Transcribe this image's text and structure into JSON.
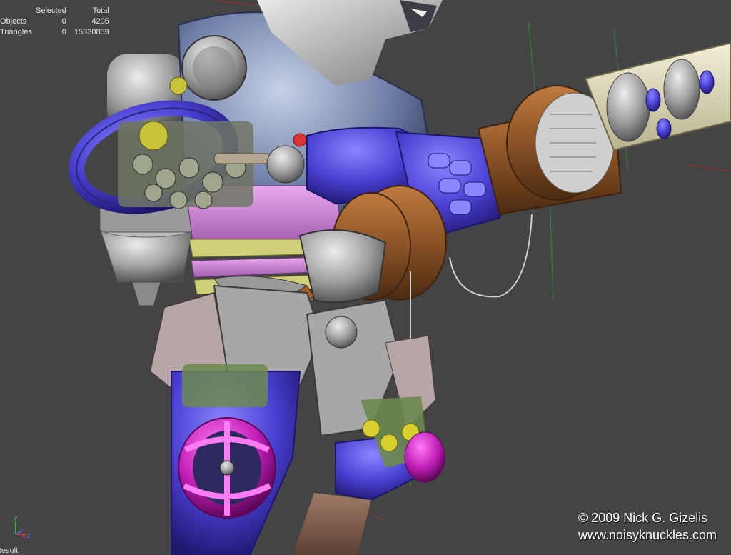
{
  "stats": {
    "header": {
      "label": "",
      "selected": "Selected",
      "total": "Total"
    },
    "rows": [
      {
        "label": "Objects",
        "selected": "0",
        "total": "4205"
      },
      {
        "label": "Triangles",
        "selected": "0",
        "total": "15320859"
      }
    ]
  },
  "copyright": {
    "line1": "© 2009 Nick G. Gizelis",
    "line2": "www.noisyknuckles.com"
  },
  "axis": {
    "y": "Y",
    "x": "X",
    "z": "Z"
  },
  "status_label": "Result",
  "colors": {
    "background": "#444444",
    "armor_blue": "#4b43c8",
    "armor_magenta": "#c21fb8",
    "armor_steel": "#8a99b8",
    "bronze": "#8a5226",
    "metal_gray": "#9a9a9a",
    "fur": "#c8c8c8"
  }
}
